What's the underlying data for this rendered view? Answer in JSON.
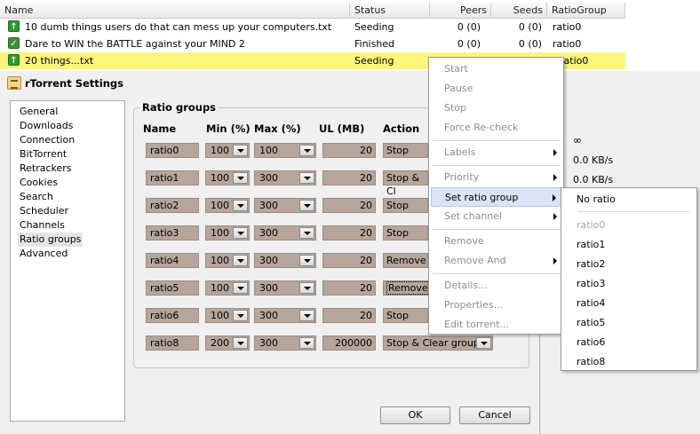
{
  "torrent_list": {
    "columns": [
      "Name",
      "Status",
      "Peers",
      "Seeds",
      "RatioGroup"
    ],
    "rows": [
      {
        "name": "10 dumb things users do that can mess up your computers.txt",
        "status": "Seeding",
        "peers": "0 (0)",
        "seeds": "0 (0)",
        "ratio_group": "ratio0",
        "icon": "seeding-arrow-icon"
      },
      {
        "name": "Dare to WIN the BATTLE against your MIND 2",
        "status": "Finished",
        "peers": "0 (0)",
        "seeds": "0 (0)",
        "ratio_group": "ratio0",
        "icon": "finished-check-icon"
      },
      {
        "name": "20 things...txt",
        "status": "Seeding",
        "peers": "",
        "seeds": "",
        "ratio_group": "ratio0",
        "icon": "seeding-arrow-icon"
      }
    ]
  },
  "dialog": {
    "title": "rTorrent Settings",
    "nav": [
      "General",
      "Downloads",
      "Connection",
      "BitTorrent",
      "Retrackers",
      "Cookies",
      "Search",
      "Scheduler",
      "Channels",
      "Ratio groups",
      "Advanced"
    ],
    "active_nav": "Ratio groups",
    "group_title": "Ratio groups",
    "column_headers": {
      "name": "Name",
      "min": "Min (%)",
      "max": "Max (%)",
      "ul": "UL (MB)",
      "action": "Action"
    },
    "rows": [
      {
        "name": "ratio0",
        "min": "100",
        "max": "100",
        "ul": "20",
        "action": "Stop"
      },
      {
        "name": "ratio1",
        "min": "100",
        "max": "300",
        "ul": "20",
        "action": "Stop & Cl"
      },
      {
        "name": "ratio2",
        "min": "100",
        "max": "300",
        "ul": "20",
        "action": "Stop"
      },
      {
        "name": "ratio3",
        "min": "100",
        "max": "300",
        "ul": "20",
        "action": "Stop"
      },
      {
        "name": "ratio4",
        "min": "100",
        "max": "300",
        "ul": "20",
        "action": "Remove"
      },
      {
        "name": "ratio5",
        "min": "100",
        "max": "300",
        "ul": "20",
        "action": "Remove"
      },
      {
        "name": "ratio6",
        "min": "100",
        "max": "300",
        "ul": "20",
        "action": "Stop"
      },
      {
        "name": "ratio8",
        "min": "200",
        "max": "300",
        "ul": "200000",
        "action": "Stop & Clear group"
      }
    ],
    "ok_label": "OK",
    "cancel_label": "Cancel"
  },
  "right_panel": {
    "infinity": "∞",
    "speed1": "0.0 KB/s",
    "speed2": "0.0 KB/s"
  },
  "context_menu": {
    "items": [
      {
        "label": "Start",
        "enabled": false
      },
      {
        "label": "Pause",
        "enabled": false
      },
      {
        "label": "Stop",
        "enabled": false
      },
      {
        "label": "Force Re-check",
        "enabled": false
      },
      {
        "label": "Labels",
        "enabled": false,
        "submenu": true
      },
      {
        "label": "Priority",
        "enabled": false,
        "submenu": true
      },
      {
        "label": "Set ratio group",
        "enabled": true,
        "submenu": true,
        "highlighted": true
      },
      {
        "label": "Set channel",
        "enabled": false,
        "submenu": true
      },
      {
        "label": "Remove",
        "enabled": false
      },
      {
        "label": "Remove And",
        "enabled": false,
        "submenu": true
      },
      {
        "label": "Details...",
        "enabled": false
      },
      {
        "label": "Properties...",
        "enabled": false
      },
      {
        "label": "Edit torrent...",
        "enabled": false
      }
    ]
  },
  "ratio_submenu": {
    "items": [
      "No ratio",
      "ratio0",
      "ratio1",
      "ratio2",
      "ratio3",
      "ratio4",
      "ratio5",
      "ratio6",
      "ratio8"
    ],
    "disabled": [
      "ratio0"
    ]
  }
}
